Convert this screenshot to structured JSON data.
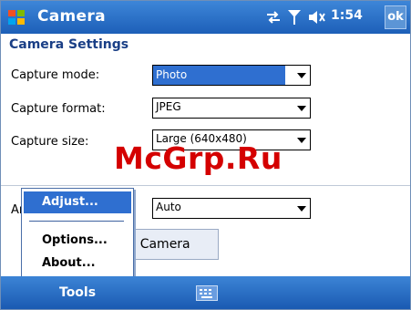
{
  "title_bar": {
    "app_title": "Camera",
    "time": "1:54",
    "ok_label": "ok",
    "icons": [
      "start-flag-icon",
      "connectivity-icon",
      "signal-icon",
      "volume-icon"
    ]
  },
  "page": {
    "section_title": "Camera Settings"
  },
  "settings": {
    "capture_mode_label": "Capture mode:",
    "capture_mode_value": "Photo",
    "capture_format_label": "Capture format:",
    "capture_format_value": "JPEG",
    "capture_size_label": "Capture size:",
    "capture_size_value": "Large (640x480)",
    "auto_label_partial": "An",
    "auto_value": "Auto"
  },
  "start_button": {
    "label": "rt Camera"
  },
  "popup_menu": {
    "items": [
      {
        "label": "Adjust...",
        "highlighted": true
      },
      {
        "label": "Options..."
      },
      {
        "label": "About..."
      }
    ]
  },
  "bottom_bar": {
    "left_softkey": "Tools",
    "input_icon": "keyboard-icon"
  },
  "watermark": "McGrp.Ru",
  "colors": {
    "bar_blue": "#1d5fb8",
    "highlight": "#2f6fd0",
    "section_title": "#1a3f86",
    "watermark": "#d40000"
  }
}
